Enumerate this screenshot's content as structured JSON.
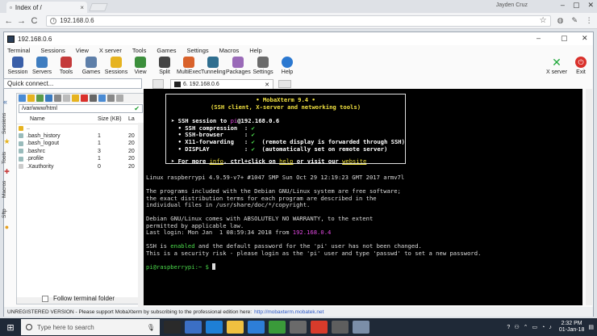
{
  "browser": {
    "tab_title": "Index of /",
    "tab_close": "×",
    "profile": "Jayden Cruz",
    "address": "192.168.0.6",
    "back": "←",
    "forward": "→",
    "reload": "C",
    "star": "☆"
  },
  "moba": {
    "title": "192.168.0.6",
    "menu": [
      "Terminal",
      "Sessions",
      "View",
      "X server",
      "Tools",
      "Games",
      "Settings",
      "Macros",
      "Help"
    ],
    "toolbar": [
      {
        "label": "Session",
        "color": "#3a5fa8"
      },
      {
        "label": "Servers",
        "color": "#3f7dc0"
      },
      {
        "label": "Tools",
        "color": "#c43a3a"
      },
      {
        "label": "Games",
        "color": "#5e7fa9"
      },
      {
        "label": "Sessions",
        "color": "#e6b320"
      },
      {
        "label": "View",
        "color": "#3c8f3c"
      },
      {
        "label": "Split",
        "color": "#444444"
      },
      {
        "label": "MultiExec",
        "color": "#d9622b"
      },
      {
        "label": "Tunneling",
        "color": "#2f6e8f"
      },
      {
        "label": "Packages",
        "color": "#9a6ab8"
      },
      {
        "label": "Settings",
        "color": "#6b6b6b"
      },
      {
        "label": "Help",
        "color": "#2b78d0"
      }
    ],
    "xserver_label": "X server",
    "exit_label": "Exit",
    "quick_connect": "Quick connect...",
    "vtabs": [
      "Sessions",
      "Tools",
      "Macros",
      "Sftp"
    ],
    "path": "/var/www/html",
    "file_columns": [
      "Name",
      "Size (KB)",
      "La"
    ],
    "files": [
      {
        "name": "..",
        "size": "",
        "last": ""
      },
      {
        "name": ".bash_history",
        "size": "1",
        "last": "20"
      },
      {
        "name": ".bash_logout",
        "size": "1",
        "last": "20"
      },
      {
        "name": ".bashrc",
        "size": "3",
        "last": "20"
      },
      {
        "name": ".profile",
        "size": "1",
        "last": "20"
      },
      {
        "name": ".Xauthority",
        "size": "0",
        "last": "20"
      }
    ],
    "follow_label": "Follow terminal folder",
    "terminal_tab": "6. 192.168.0.6",
    "status_text": "UNREGISTERED VERSION  -  Please support MobaXterm by subscribing to the professional edition here:",
    "status_link": "http://mobaxterm.mobatek.net"
  },
  "terminal": {
    "banner_title": "• MobaXterm 9.4 •",
    "banner_sub": "(SSH client, X-server and networking tools)",
    "ssh_prefix": "➤ SSH session to ",
    "ssh_user": "pi",
    "ssh_host": "@192.168.0.6",
    "rows": [
      {
        "label": "  • SSH compression  : ",
        "value": "✔",
        "note": ""
      },
      {
        "label": "  • SSH-browser      : ",
        "value": "✔",
        "note": ""
      },
      {
        "label": "  • X11-forwarding   : ",
        "value": "✔",
        "note": "  (remote display is forwarded through SSH)"
      },
      {
        "label": "  • DISPLAY          : ",
        "value": "✔",
        "note": "  (automatically set on remote server)"
      }
    ],
    "more_prefix": "➤ For more ",
    "more_info": "info",
    "more_mid": ", ctrl+click on ",
    "more_help": "help",
    "more_or": " or visit our ",
    "more_site": "website",
    "uname": "Linux raspberrypi 4.9.59-v7+ #1047 SMP Sun Oct 29 12:19:23 GMT 2017 armv7l",
    "debian": [
      "The programs included with the Debian GNU/Linux system are free software;",
      "the exact distribution terms for each program are described in the",
      "individual files in /usr/share/doc/*/copyright."
    ],
    "warranty": [
      "Debian GNU/Linux comes with ABSOLUTELY NO WARRANTY, to the extent",
      "permitted by applicable law."
    ],
    "last_login_prefix": "Last login: Mon Jan  1 08:59:34 2018 from ",
    "last_login_ip": "192.168.0.4",
    "ssh_enabled_prefix": "SSH is ",
    "ssh_enabled_word": "enabled",
    "ssh_enabled_rest": " and the default password for the 'pi' user has not been changed.",
    "security": "This is a security risk - please login as the 'pi' user and type 'passwd' to set a new password.",
    "prompt": "pi@raspberrypi:~ $ "
  },
  "taskbar": {
    "search_placeholder": "Type here to search",
    "time": "2:32 PM",
    "date": "01-Jan-18",
    "apps": [
      "#2a2a2a",
      "#3b6fc5",
      "#1e7fd6",
      "#f0c040",
      "#2d7ed8",
      "#3a9a3a",
      "#6a6a6a",
      "#d83b2b",
      "#5e5e5e",
      "#7b8ea8"
    ]
  }
}
